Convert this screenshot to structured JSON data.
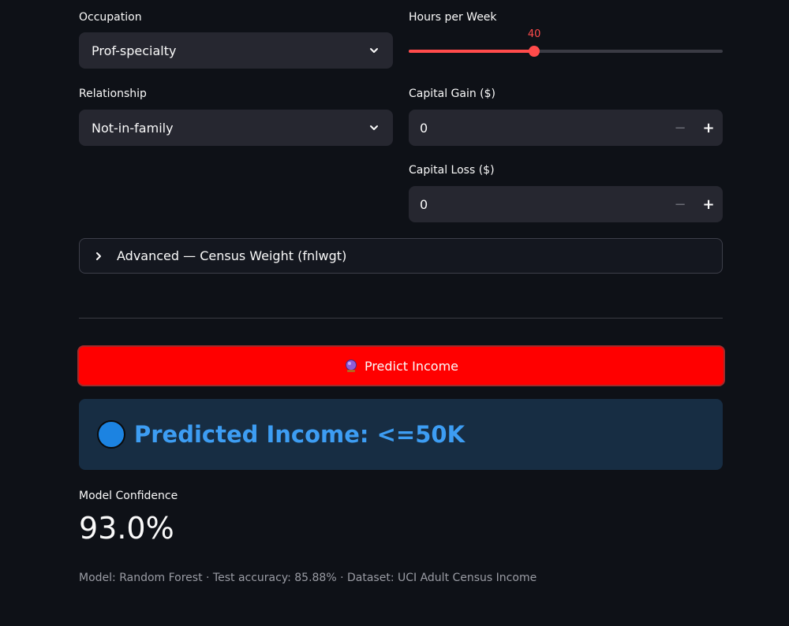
{
  "occupation": {
    "label": "Occupation",
    "value": "Prof-specialty"
  },
  "hours_per_week": {
    "label": "Hours per Week",
    "value": "40",
    "fraction": 0.4
  },
  "relationship": {
    "label": "Relationship",
    "value": "Not-in-family"
  },
  "capital_gain": {
    "label": "Capital Gain ($)",
    "value": "0",
    "minus": "−",
    "plus": "+"
  },
  "capital_loss": {
    "label": "Capital Loss ($)",
    "value": "0",
    "minus": "−",
    "plus": "+"
  },
  "advanced": {
    "label": "Advanced — Census Weight (fnlwgt)"
  },
  "predict_button": {
    "label": "Predict Income",
    "icon": "crystal-ball-icon"
  },
  "result": {
    "text": "Predicted Income: <=50K",
    "icon": "blue-circle-icon",
    "color": "#3d9df3",
    "background": "#172d43"
  },
  "metric": {
    "label": "Model Confidence",
    "value": "93.0%"
  },
  "footer": {
    "text": "Model: Random Forest · Test accuracy: 85.88% · Dataset: UCI Adult Census Income"
  },
  "colors": {
    "background": "#0e1117",
    "accent": "#ff4b4b",
    "button": "#ff0000",
    "input_bg": "#262730"
  }
}
